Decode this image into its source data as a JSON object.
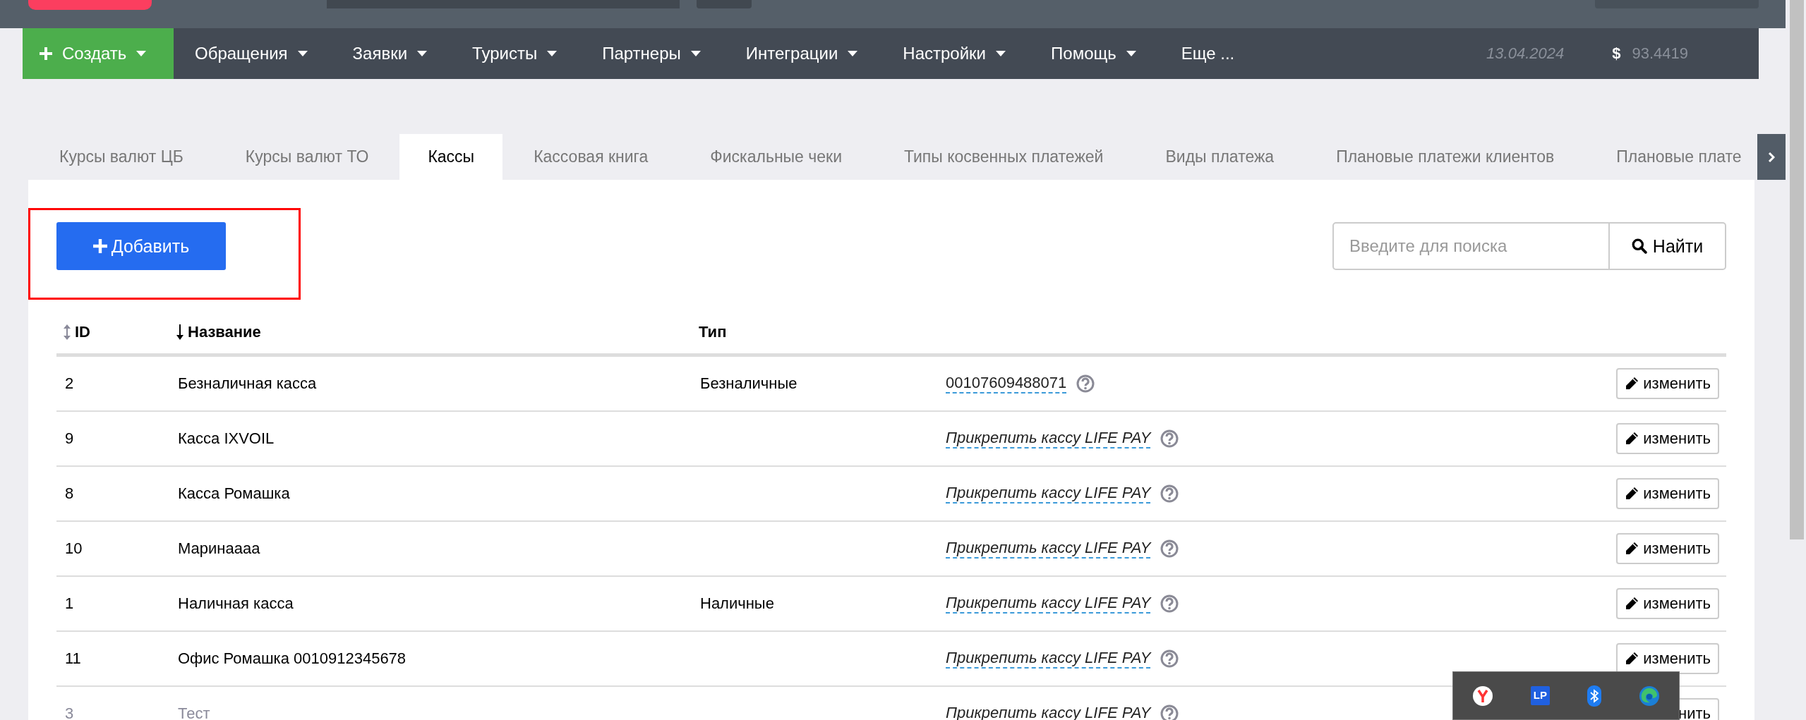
{
  "nav": {
    "create": {
      "label": "Создать"
    },
    "items": [
      {
        "label": "Обращения",
        "dropdown": true
      },
      {
        "label": "Заявки",
        "dropdown": true
      },
      {
        "label": "Туристы",
        "dropdown": true
      },
      {
        "label": "Партнеры",
        "dropdown": true
      },
      {
        "label": "Интеграции",
        "dropdown": true
      },
      {
        "label": "Настройки",
        "dropdown": true
      },
      {
        "label": "Помощь",
        "dropdown": true
      },
      {
        "label": "Еще ...",
        "dropdown": false
      }
    ],
    "date": "13.04.2024",
    "currency_symbol": "$",
    "rate": "93.4419"
  },
  "tabs": [
    {
      "label": "Курсы валют ЦБ",
      "selected": false
    },
    {
      "label": "Курсы валют ТО",
      "selected": false
    },
    {
      "label": "Кассы",
      "selected": true
    },
    {
      "label": "Кассовая книга",
      "selected": false
    },
    {
      "label": "Фискальные чеки",
      "selected": false
    },
    {
      "label": "Типы косвенных платежей",
      "selected": false
    },
    {
      "label": "Виды платежа",
      "selected": false
    },
    {
      "label": "Плановые платежи клиентов",
      "selected": false
    },
    {
      "label": "Плановые плате",
      "selected": false
    }
  ],
  "add_button": {
    "label": "Добавить",
    "highlighted": true
  },
  "search": {
    "placeholder": "Введите для поиска",
    "button": "Найти"
  },
  "table": {
    "columns": [
      {
        "label": "ID",
        "sortable": true,
        "sorted": false
      },
      {
        "label": "Название",
        "sortable": true,
        "sorted": true
      },
      {
        "label": "Тип",
        "sortable": false
      }
    ],
    "rows": [
      {
        "id": "2",
        "name": "Безналичная касса",
        "type": "Безналичные",
        "link": {
          "text": "00107609488071",
          "kind": "number"
        },
        "edit": "изменить",
        "disabled": false
      },
      {
        "id": "9",
        "name": "Касса IXVOIL",
        "link": {
          "text": "Прикрепить кассу LIFE PAY",
          "kind": "action"
        },
        "edit": "изменить",
        "disabled": false
      },
      {
        "id": "8",
        "name": "Касса Ромашка",
        "link": {
          "text": "Прикрепить кассу LIFE PAY",
          "kind": "action"
        },
        "edit": "изменить",
        "disabled": false
      },
      {
        "id": "10",
        "name": "Маринаааа",
        "link": {
          "text": "Прикрепить кассу LIFE PAY",
          "kind": "action"
        },
        "edit": "изменить",
        "disabled": false
      },
      {
        "id": "1",
        "name": "Наличная касса",
        "type": "Наличные",
        "link": {
          "text": "Прикрепить кассу LIFE PAY",
          "kind": "action"
        },
        "edit": "изменить",
        "disabled": false
      },
      {
        "id": "11",
        "name": "Офис Ромашка 0010912345678",
        "link": {
          "text": "Прикрепить кассу LIFE PAY",
          "kind": "action"
        },
        "edit": "изменить",
        "disabled": false
      },
      {
        "id": "3",
        "name": "Тест",
        "link": {
          "text": "Прикрепить кассу LIFE PAY",
          "kind": "action"
        },
        "edit": "нить",
        "edit_icon": false,
        "disabled": true
      }
    ]
  },
  "tray": {
    "icons": [
      {
        "kind": "y-browser"
      },
      {
        "kind": "lp",
        "label": "LP"
      },
      {
        "kind": "bluetooth"
      },
      {
        "kind": "edge"
      }
    ]
  }
}
